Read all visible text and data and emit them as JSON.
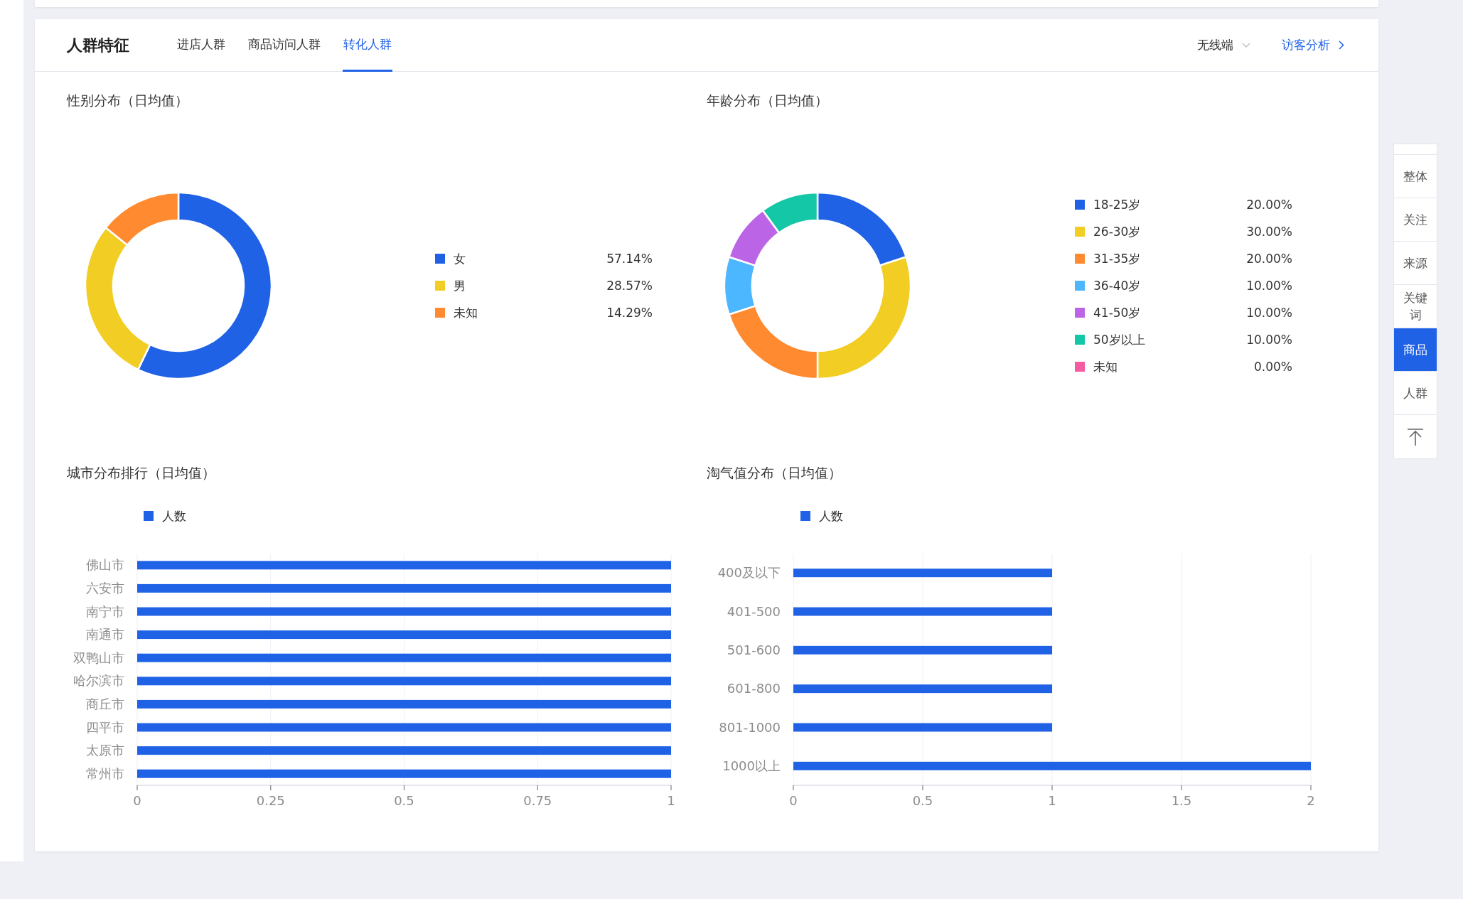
{
  "header": {
    "title": "人群特征",
    "tabs": [
      {
        "label": "进店人群",
        "selected": false
      },
      {
        "label": "商品访问人群",
        "selected": false
      },
      {
        "label": "转化人群",
        "selected": true
      }
    ],
    "device_dropdown": {
      "value": "无线端"
    },
    "visitor_link": {
      "label": "访客分析"
    }
  },
  "gender": {
    "title": "性别分布（日均值）",
    "chart_data": {
      "type": "donut",
      "categories": [
        "女",
        "男",
        "未知"
      ],
      "values": [
        57.14,
        28.57,
        14.29
      ],
      "value_labels": [
        "57.14%",
        "28.57%",
        "14.29%"
      ],
      "colors": [
        "#2062e6",
        "#f2cd24",
        "#ff8a30"
      ],
      "legend": true
    }
  },
  "age": {
    "title": "年龄分布（日均值）",
    "chart_data": {
      "type": "donut",
      "categories": [
        "18-25岁",
        "26-30岁",
        "31-35岁",
        "36-40岁",
        "41-50岁",
        "50岁以上",
        "未知"
      ],
      "values": [
        20,
        30,
        20,
        10,
        10,
        10,
        0
      ],
      "value_labels": [
        "20.00%",
        "30.00%",
        "20.00%",
        "10.00%",
        "10.00%",
        "10.00%",
        "0.00%"
      ],
      "colors": [
        "#2062e6",
        "#f2cd24",
        "#ff8a30",
        "#4cb6ff",
        "#bb65e6",
        "#14c7a6",
        "#f55ba0"
      ],
      "legend": true
    }
  },
  "city": {
    "title": "城市分布排行（日均值）",
    "chart_data": {
      "type": "bar",
      "orientation": "horizontal",
      "categories": [
        "佛山市",
        "六安市",
        "南宁市",
        "南通市",
        "双鸭山市",
        "哈尔滨市",
        "商丘市",
        "四平市",
        "太原市",
        "常州市"
      ],
      "series": [
        {
          "name": "人数",
          "color": "#2062e6",
          "values": [
            1,
            1,
            1,
            1,
            1,
            1,
            1,
            1,
            1,
            1
          ]
        }
      ],
      "xlim": [
        0,
        1
      ],
      "xticks": [
        0,
        0.25,
        0.5,
        0.75,
        1
      ],
      "grid": true,
      "legend": true
    }
  },
  "taoqi": {
    "title": "淘气值分布（日均值）",
    "chart_data": {
      "type": "bar",
      "orientation": "horizontal",
      "categories": [
        "400及以下",
        "401-500",
        "501-600",
        "601-800",
        "801-1000",
        "1000以上"
      ],
      "series": [
        {
          "name": "人数",
          "color": "#2062e6",
          "values": [
            1,
            1,
            1,
            1,
            1,
            2
          ]
        }
      ],
      "xlim": [
        0,
        2
      ],
      "xticks": [
        0,
        0.5,
        1,
        1.5,
        2
      ],
      "grid": true,
      "legend": true
    }
  },
  "side_nav": {
    "items": [
      {
        "label": "整体",
        "selected": false
      },
      {
        "label": "关注",
        "selected": false
      },
      {
        "label": "来源",
        "selected": false
      },
      {
        "label": "关键词",
        "selected": false
      },
      {
        "label": "商品",
        "selected": true
      },
      {
        "label": "人群",
        "selected": false
      }
    ]
  }
}
